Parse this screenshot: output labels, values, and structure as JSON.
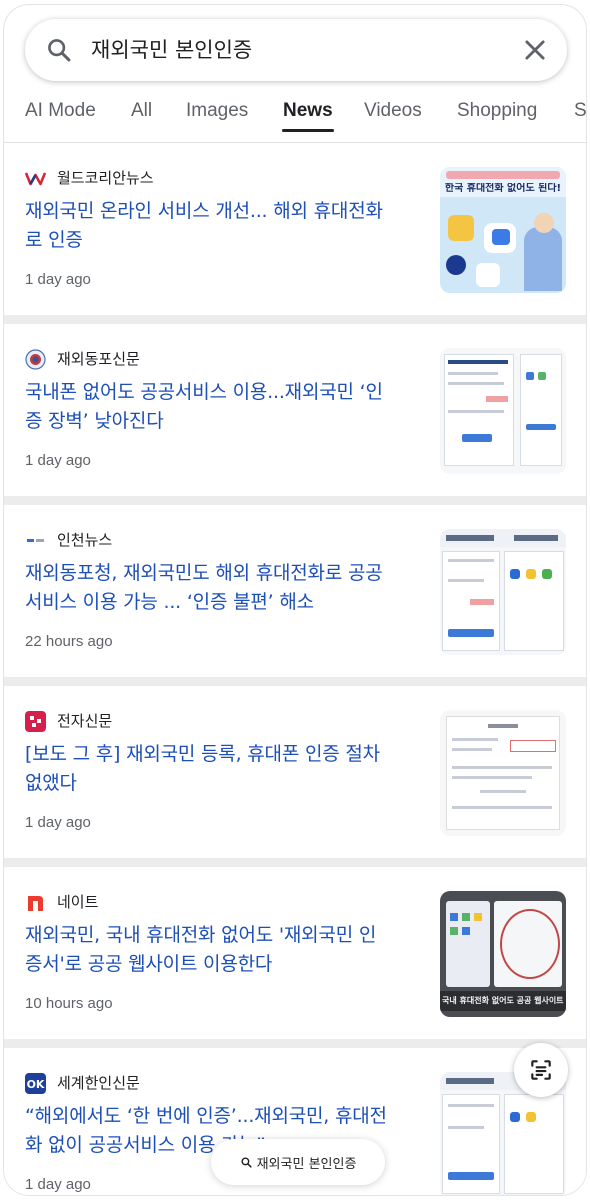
{
  "search": {
    "query": "재외국민 본인인증"
  },
  "tabs": [
    "AI Mode",
    "All",
    "Images",
    "News",
    "Videos",
    "Shopping",
    "S"
  ],
  "active_tab": "News",
  "results": [
    {
      "source": "월드코리안뉴스",
      "logo": "w-logo",
      "headline": [
        "재외국민 온라인 서비스 개선... 해외 휴대전화",
        "로 인증"
      ],
      "time": "1 day ago",
      "thumb_text": "한국 휴대전화 없어도 된다!"
    },
    {
      "source": "재외동포신문",
      "logo": "round-emblem-logo",
      "headline": [
        "국내폰 없어도 공공서비스 이용...재외국민 ‘인",
        "증 장벽’ 낮아진다"
      ],
      "time": "1 day ago"
    },
    {
      "source": "인천뉴스",
      "logo": "small-text-logo",
      "headline": [
        "재외동포청, 재외국민도 해외 휴대전화로 공공",
        "서비스 이용 가능 ... ‘인증 불편’ 해소"
      ],
      "time": "22 hours ago"
    },
    {
      "source": "전자신문",
      "logo": "red-square-logo",
      "headline": [
        "[보도 그 후] 재외국민 등록, 휴대폰 인증 절차",
        "없앴다"
      ],
      "time": "1 day ago"
    },
    {
      "source": "네이트",
      "logo": "n-logo",
      "headline": [
        "재외국민, 국내 휴대전화 없어도 '재외국민 인",
        "증서'로 공공 웹사이트 이용한다"
      ],
      "time": "10 hours ago",
      "thumb_text": "국내 휴대전화 없어도 공공 웹사이트 이용"
    },
    {
      "source": "세계한인신문",
      "logo": "ok-logo",
      "headline": [
        "“해외에서도 ‘한 번에 인증’...재외국민, 휴대전",
        "화 없이 공공서비스 이용 가능”"
      ],
      "time": "1 day ago"
    }
  ],
  "floating": {
    "lens_icon": "lens-scan-icon",
    "pill_text": "재외국민 본인인증"
  },
  "colors": {
    "link": "#1d4fb8",
    "muted": "#5f6368",
    "separator": "#ececec"
  }
}
